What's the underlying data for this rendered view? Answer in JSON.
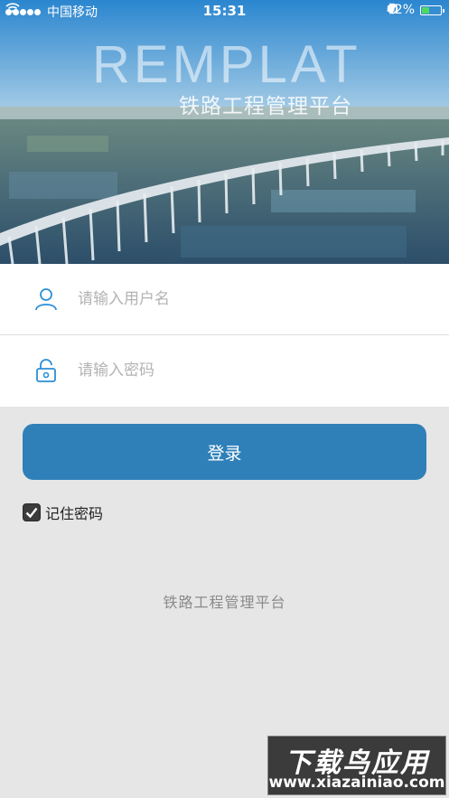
{
  "status_bar": {
    "carrier": "中国移动",
    "time": "15:31",
    "battery_percent": "42%",
    "battery_level": 0.42,
    "icons": [
      "signal-dots-icon",
      "wifi-icon",
      "rotation-lock-icon",
      "location-icon",
      "alarm-icon",
      "bluetooth-icon",
      "battery-icon"
    ]
  },
  "hero": {
    "brand": "REMPLAT",
    "subtitle": "铁路工程管理平台"
  },
  "login_form": {
    "username": {
      "placeholder": "请输入用户名",
      "value": "",
      "icon": "user-icon"
    },
    "password": {
      "placeholder": "请输入密码",
      "value": "",
      "icon": "lock-icon"
    },
    "submit_label": "登录",
    "remember_label": "记住密码",
    "remember_checked": true
  },
  "footer": {
    "text": "铁路工程管理平台"
  },
  "watermark": {
    "title": "下载鸟应用",
    "url": "www.xiazainiao.com"
  },
  "colors": {
    "primary": "#2f80b9",
    "icon_blue": "#2b8fd6",
    "page_background": "#e6e6e6",
    "battery_green": "#4cd964"
  }
}
